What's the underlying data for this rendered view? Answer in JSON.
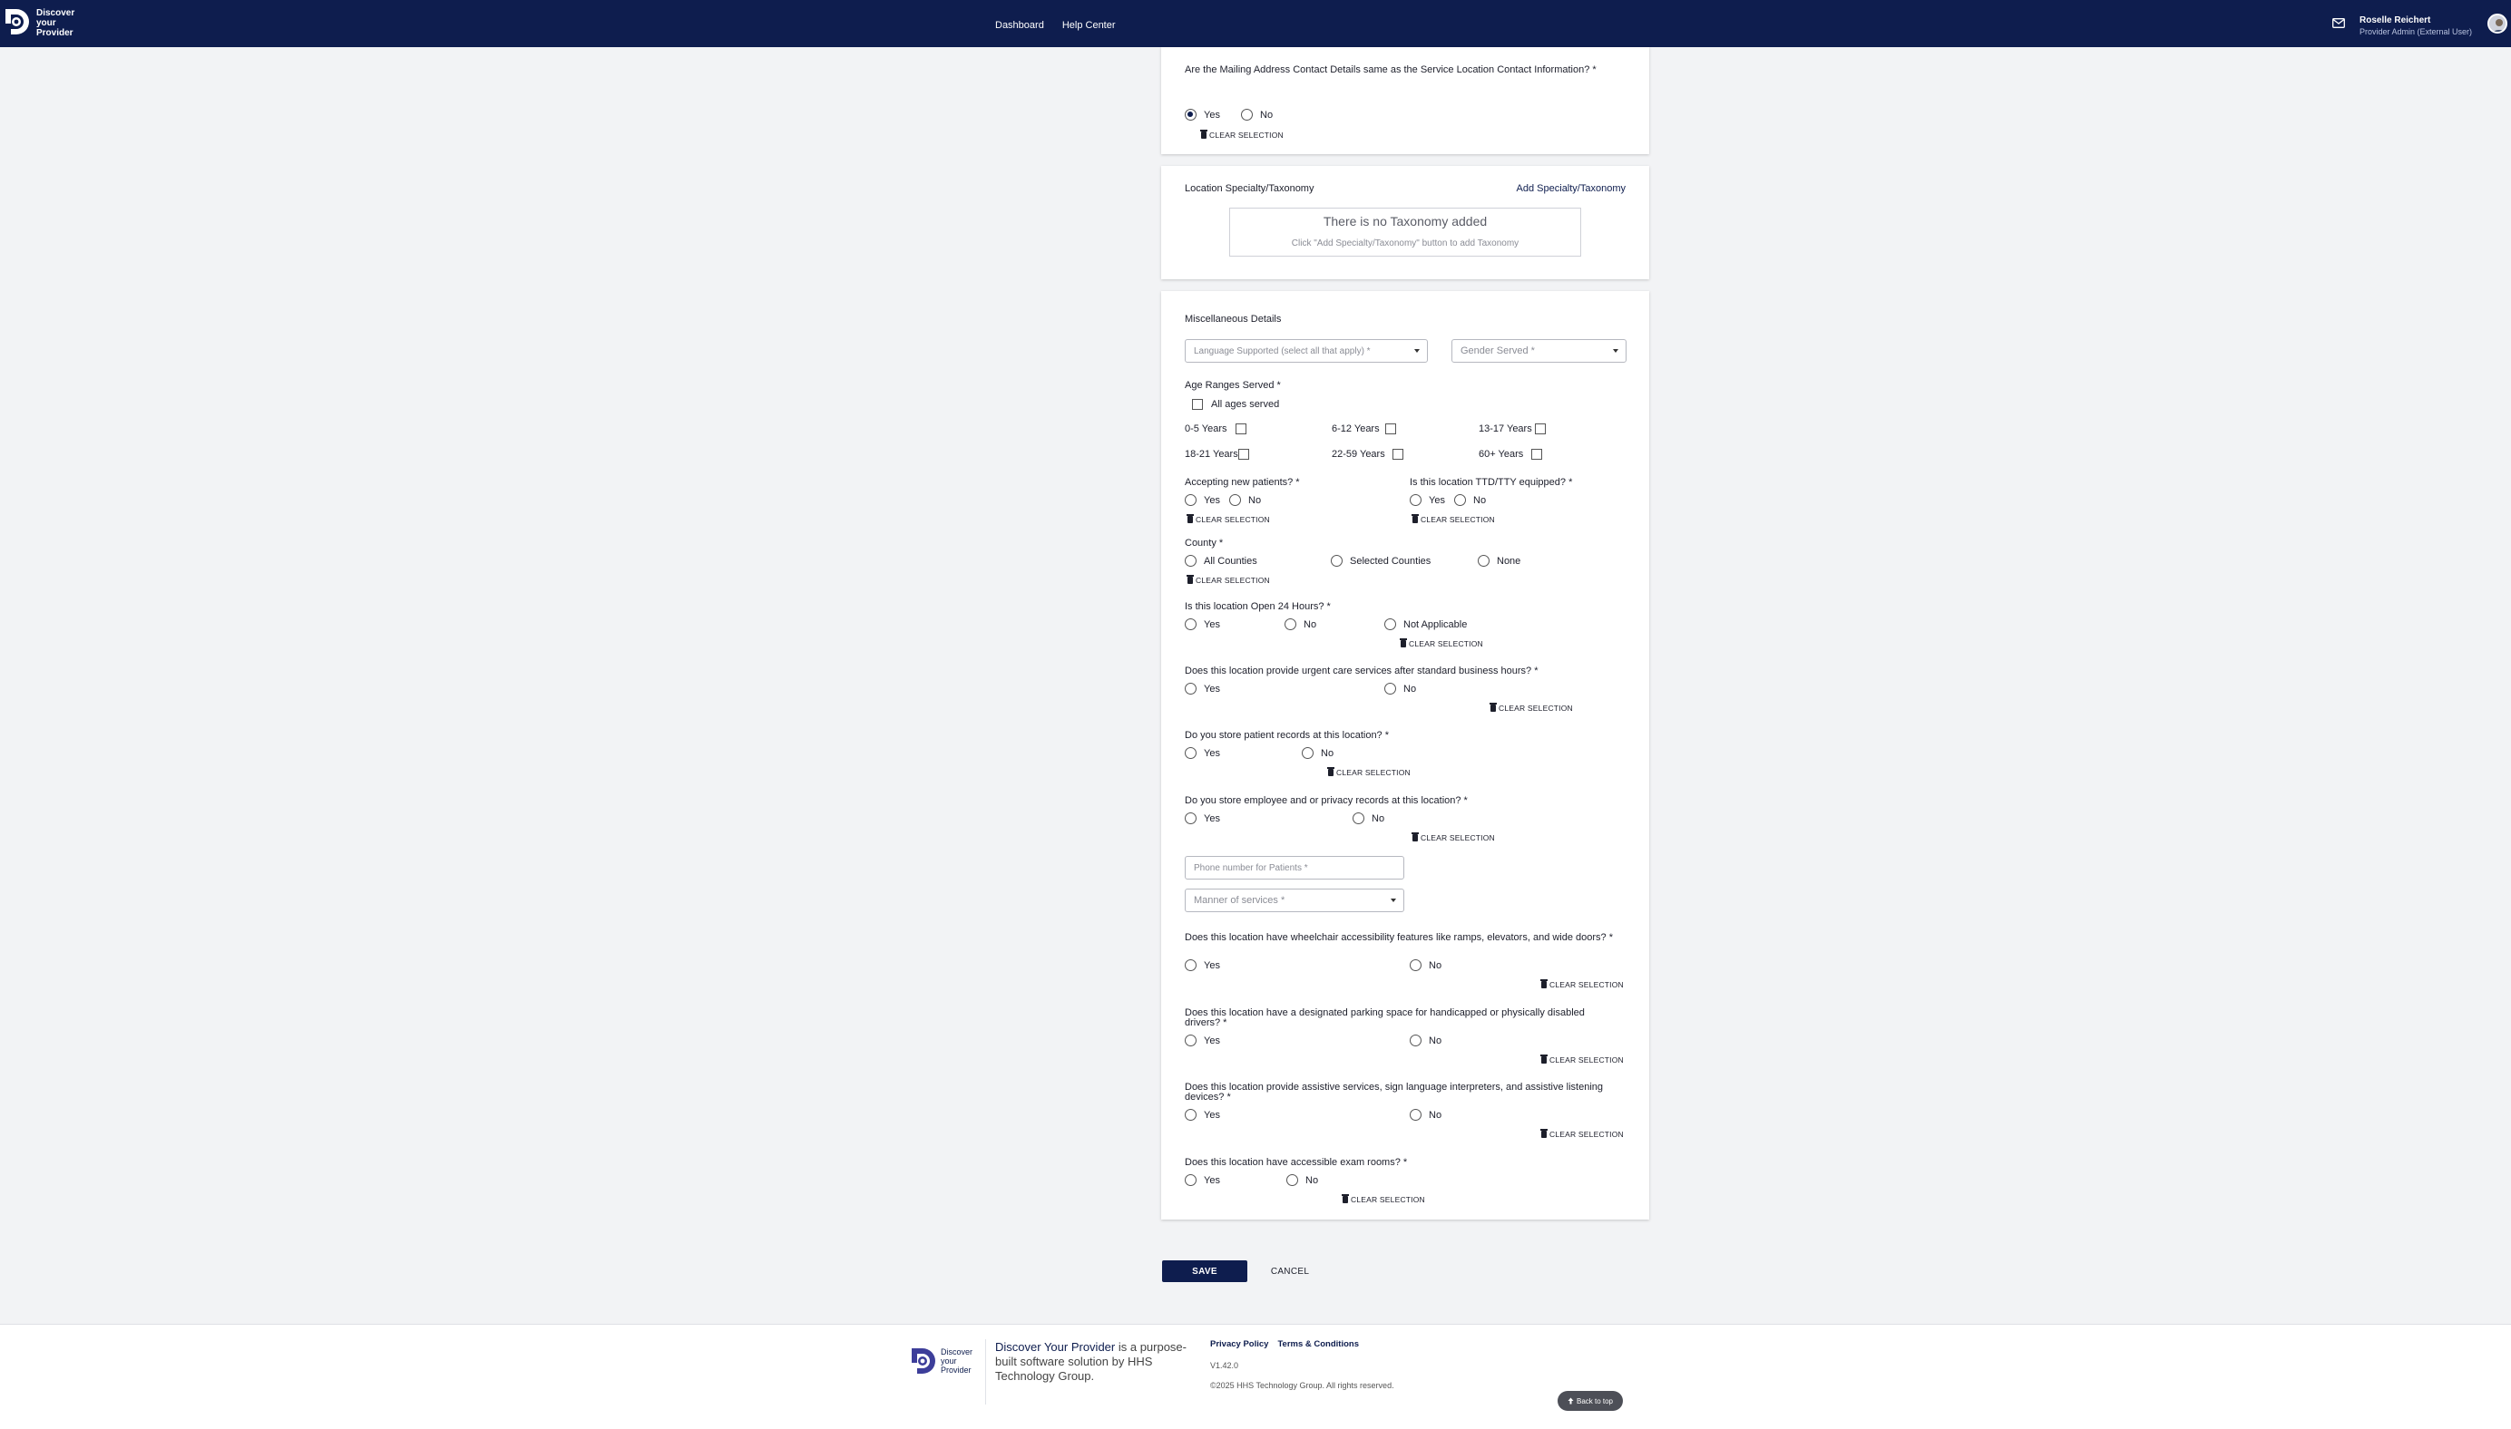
{
  "header": {
    "logo_line1": "Discover",
    "logo_line2": "your",
    "logo_line3": "Provider",
    "nav": [
      "Dashboard",
      "Help Center"
    ],
    "user_name": "Roselle Reichert",
    "user_role": "Provider Admin (External User)"
  },
  "mailing": {
    "question": "Are the Mailing Address Contact Details same as the Service Location Contact Information? *",
    "yes": "Yes",
    "no": "No",
    "selected": "Yes",
    "clear": "CLEAR SELECTION"
  },
  "taxonomy": {
    "title": "Location Specialty/Taxonomy",
    "add_link": "Add Specialty/Taxonomy",
    "empty_title": "There is no Taxonomy added",
    "empty_hint": "Click \"Add Specialty/Taxonomy\" button to add Taxonomy"
  },
  "misc": {
    "title": "Miscellaneous Details",
    "language_placeholder": "Language Supported (select all that apply) *",
    "gender_placeholder": "Gender Served *",
    "age_title": "Age Ranges Served *",
    "all_ages": "All ages served",
    "ages": [
      "0-5 Years",
      "6-12 Years",
      "13-17 Years",
      "18-21 Years",
      "22-59 Years",
      "60+ Years"
    ],
    "accepting_q": "Accepting new patients? *",
    "ttd_q": "Is this location TTD/TTY equipped? *",
    "county_q": "County *",
    "county_opts": [
      "All Counties",
      "Selected Counties",
      "None"
    ],
    "open24_q": "Is this location Open 24 Hours? *",
    "na": "Not Applicable",
    "urgent_q": "Does this location provide urgent care services after standard business hours? *",
    "records_q": "Do you store patient records at this location? *",
    "privacy_q": "Do you store employee and or privacy records at this location? *",
    "phone_placeholder": "Phone number for Patients *",
    "manner_placeholder": "Manner of services *",
    "wheelchair_q": "Does this location have wheelchair accessibility features like ramps, elevators, and wide doors? *",
    "parking_q": "Does this location have a designated parking space for handicapped or physically disabled drivers? *",
    "assistive_q": "Does this location provide assistive services, sign language interpreters, and assistive listening devices? *",
    "exam_q": "Does this location have accessible exam rooms? *",
    "yes": "Yes",
    "no": "No",
    "clear": "CLEAR SELECTION"
  },
  "actions": {
    "save": "SAVE",
    "cancel": "CANCEL"
  },
  "footer": {
    "brand": "Discover Your Provider",
    "desc_rest": " is a purpose-built software solution by HHS Technology Group.",
    "privacy": "Privacy Policy",
    "terms": "Terms & Conditions",
    "version": "V1.42.0",
    "copyright": "©2025 HHS Technology Group. All rights reserved.",
    "back_to_top": "Back to top"
  },
  "colors": {
    "brand": "#0e1d4e",
    "background": "#f2f3f5"
  }
}
